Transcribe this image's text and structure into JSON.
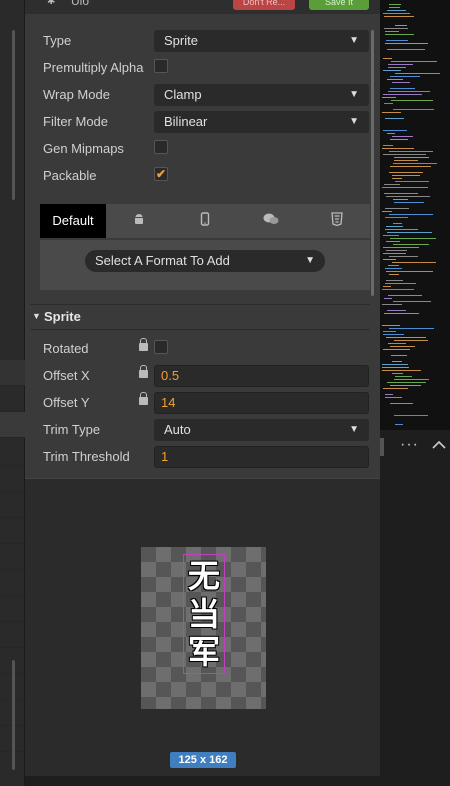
{
  "header": {
    "title": "Ulo",
    "revert_label": "Don't Re...",
    "apply_label": "Save It"
  },
  "texture": {
    "type": {
      "label": "Type",
      "value": "Sprite"
    },
    "premultiply_alpha": {
      "label": "Premultiply Alpha",
      "checked": false
    },
    "wrap_mode": {
      "label": "Wrap Mode",
      "value": "Clamp"
    },
    "filter_mode": {
      "label": "Filter Mode",
      "value": "Bilinear"
    },
    "gen_mipmaps": {
      "label": "Gen Mipmaps",
      "checked": false
    },
    "packable": {
      "label": "Packable",
      "checked": true,
      "check_glyph": "✔"
    }
  },
  "platform_tabs": [
    {
      "label": "Default",
      "icon": "default"
    },
    {
      "label": "",
      "icon": "android-icon"
    },
    {
      "label": "",
      "icon": "phone-icon"
    },
    {
      "label": "",
      "icon": "chat-icon"
    },
    {
      "label": "",
      "icon": "html5-icon"
    }
  ],
  "tab_default_label": "Default",
  "format_select": {
    "placeholder": "Select A Format To Add"
  },
  "sprite_section": {
    "title": "Sprite",
    "rotated": {
      "label": "Rotated",
      "checked": false
    },
    "offset_x": {
      "label": "Offset X",
      "value": "0.5"
    },
    "offset_y": {
      "label": "Offset Y",
      "value": "14"
    },
    "trim_type": {
      "label": "Trim Type",
      "value": "Auto"
    },
    "trim_threshold": {
      "label": "Trim Threshold",
      "value": "1"
    }
  },
  "preview": {
    "sprite_text": [
      "无",
      "当",
      "军"
    ],
    "size_label": "125 x 162"
  },
  "right_toolbar": {
    "more_label": "···",
    "collapse_label": "^"
  },
  "colors": {
    "accent_orange": "#f0a030",
    "badge_blue": "#3f7fc0",
    "revert_red": "#b44444",
    "apply_green": "#5a9e3a",
    "sprite_border": "#c040c0"
  }
}
